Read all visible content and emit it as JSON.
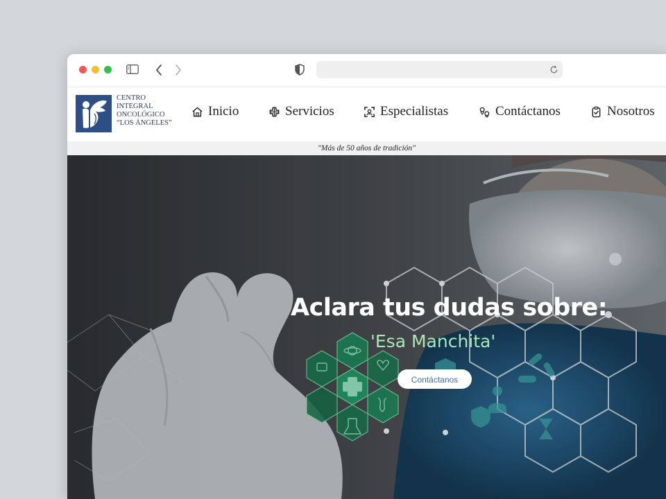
{
  "site": {
    "logo_lines": [
      "CENTRO",
      "INTEGRAL",
      "ONCOLÓGICO",
      "“LOS ÁNGELES”"
    ],
    "tagline": "\"Más de 50 años de tradición\""
  },
  "nav": {
    "items": [
      {
        "label": "Inicio",
        "icon": "home-icon"
      },
      {
        "label": "Servicios",
        "icon": "medical-cross-icon"
      },
      {
        "label": "Especialistas",
        "icon": "face-scan-icon"
      },
      {
        "label": "Contáctanos",
        "icon": "location-pins-icon"
      },
      {
        "label": "Nosotros",
        "icon": "clipboard-check-icon"
      }
    ]
  },
  "hero": {
    "title": "Aclara tus dudas sobre:",
    "subtitle": "'Esa Manchita'",
    "button_label": "Contáctanos"
  },
  "colors": {
    "logo_blue": "#2e4f86",
    "subtitle_green": "#a8e8b8",
    "button_text": "#3e6fb5",
    "hex_green": "#1f9a5f"
  }
}
